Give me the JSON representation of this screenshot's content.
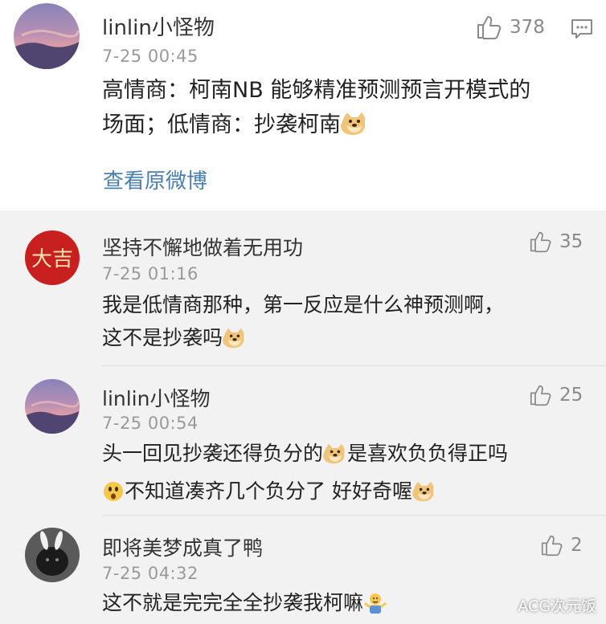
{
  "main_comment": {
    "username": "linlin小怪物",
    "time": "7-25 00:45",
    "like_count": "378",
    "text_line1": "高情商：柯南NB 能够精准预测预言开模式的",
    "text_line2": "场面；低情商：抄袭柯南",
    "view_original": "查看原微博"
  },
  "replies": [
    {
      "username": "坚持不懈地做着无用功",
      "time": "7-25 01:16",
      "like_count": "35",
      "text_line1": "我是低情商那种，第一反应是什么神预测啊，",
      "text_line2": "这不是抄袭吗"
    },
    {
      "username": "linlin小怪物",
      "time": "7-25 00:54",
      "like_count": "25",
      "text_line1a": "头一回见抄袭还得负分的",
      "text_line1b": "是喜欢负负得正吗",
      "text_line2a": "不知道凑齐几个负分了 好好奇喔"
    },
    {
      "username": "即将美梦成真了鸭",
      "time": "7-25 04:32",
      "like_count": "2",
      "text_line1": "这不就是完完全全抄袭我柯嘛"
    }
  ],
  "avatar_seal_text": "大吉",
  "watermark": "ACG次元饭",
  "colors": {
    "link": "#4a7fb0",
    "reply_bg": "#f2f2f2",
    "seal_red": "#c8201e"
  },
  "icons": {
    "like": "thumbs-up-icon",
    "comment": "comment-icon",
    "doge": "doge-emoji-icon",
    "surprised": "surprised-emoji-icon",
    "shrug": "shrug-emoji-icon"
  }
}
